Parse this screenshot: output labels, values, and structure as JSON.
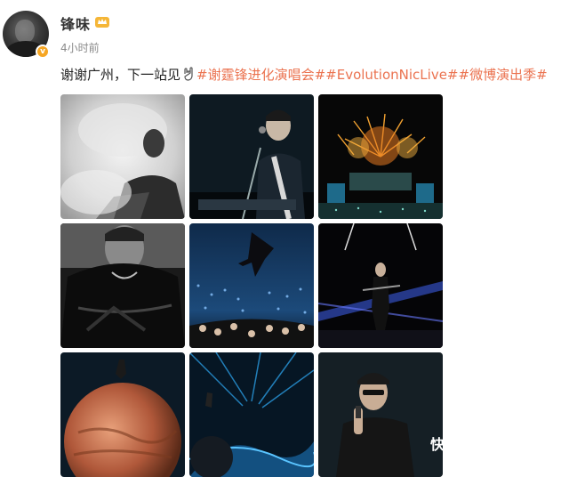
{
  "post": {
    "username": "锋味",
    "timestamp": "4小时前",
    "text_main": "谢谢广州，下一站见",
    "hashtags": [
      "#谢霆锋进化演唱会#",
      "#EvolutionNicLive#",
      "#微博演出季#"
    ],
    "verified_badge": "v"
  },
  "icons": {
    "crown": "crown-badge-icon",
    "hand": "rock-hand-icon",
    "verified": "verified-icon"
  },
  "photos": [
    {
      "row": 0,
      "col": 0,
      "desc": "photo-1"
    },
    {
      "row": 0,
      "col": 1,
      "desc": "photo-2"
    },
    {
      "row": 0,
      "col": 2,
      "desc": "photo-3"
    },
    {
      "row": 1,
      "col": 0,
      "desc": "photo-4"
    },
    {
      "row": 1,
      "col": 1,
      "desc": "photo-5"
    },
    {
      "row": 1,
      "col": 2,
      "desc": "photo-6"
    },
    {
      "row": 2,
      "col": 0,
      "desc": "photo-7"
    },
    {
      "row": 2,
      "col": 1,
      "desc": "photo-8"
    },
    {
      "row": 2,
      "col": 2,
      "desc": "photo-9"
    }
  ],
  "watermark": "快",
  "colors": {
    "hashtag": "#eb7350",
    "badge": "#f6a623"
  }
}
